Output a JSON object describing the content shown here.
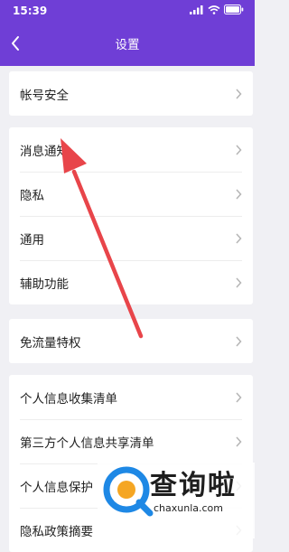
{
  "status": {
    "time": "15:39"
  },
  "nav": {
    "title": "设置"
  },
  "groups": [
    {
      "items": [
        "帐号安全"
      ]
    },
    {
      "items": [
        "消息通知",
        "隐私",
        "通用",
        "辅助功能"
      ]
    },
    {
      "items": [
        "免流量特权"
      ]
    },
    {
      "items": [
        "个人信息收集清单",
        "第三方个人信息共享清单",
        "个人信息保护",
        "隐私政策摘要"
      ]
    }
  ],
  "watermark": {
    "brand_cn": "查询啦",
    "brand_en": "chaxunla.com"
  },
  "colors": {
    "header": "#6f3ed6",
    "arrow": "#e8454a",
    "logo_blue": "#1e88e5"
  }
}
